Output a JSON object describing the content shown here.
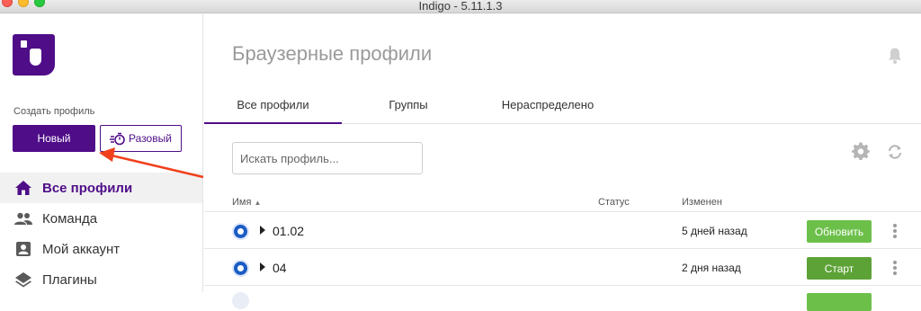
{
  "window": {
    "title": "Indigo - 5.11.1.3"
  },
  "sidebar": {
    "create_label": "Создать профиль",
    "new_button": "Новый",
    "once_button": "Разовый",
    "items": [
      {
        "label": "Все профили",
        "icon": "home-icon",
        "active": true
      },
      {
        "label": "Команда",
        "icon": "people-icon",
        "active": false
      },
      {
        "label": "Мой аккаунт",
        "icon": "account-icon",
        "active": false
      },
      {
        "label": "Плагины",
        "icon": "layers-icon",
        "active": false
      }
    ]
  },
  "main": {
    "title": "Браузерные профили",
    "tabs": [
      {
        "label": "Все профили",
        "active": true
      },
      {
        "label": "Группы",
        "active": false
      },
      {
        "label": "Нераспределено",
        "active": false
      }
    ],
    "search_placeholder": "Искать профиль...",
    "table": {
      "headers": {
        "name": "Имя",
        "status": "Статус",
        "changed": "Изменен"
      },
      "rows": [
        {
          "name": "01.02",
          "status": "",
          "changed": "5 дней назад",
          "action": "Обновить"
        },
        {
          "name": "04",
          "status": "",
          "changed": "2 дня назад",
          "action": "Старт"
        }
      ]
    }
  },
  "colors": {
    "brand": "#4f0d88",
    "update_button": "#6cc04a",
    "start_button": "#5ca236",
    "annotation_arrow": "#f0401c"
  }
}
